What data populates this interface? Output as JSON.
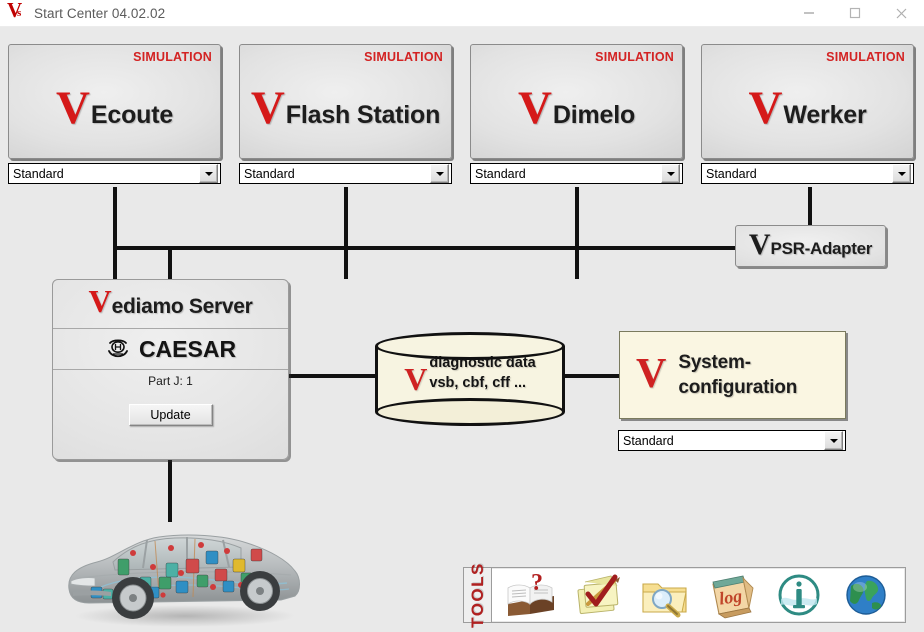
{
  "window": {
    "title": "Start Center 04.02.02",
    "logo_letter": "V",
    "logo_sub": "s",
    "controls": {
      "minimize": "minimize-button",
      "maximize": "maximize-button",
      "close": "close-button"
    }
  },
  "colors": {
    "brand_red": "#d51919",
    "simulation_red": "#d32323",
    "canvas_bg": "#e9e9e9",
    "tile_bg": "#e2e2e2",
    "db_fill": "#f7f4e1",
    "sysconf_fill": "#faf6e2",
    "tools_label_red": "#b02020",
    "line_color": "#111111"
  },
  "tiles": [
    {
      "badge": "SIMULATION",
      "mark": "V",
      "name": "Ecoute",
      "profile": "Standard"
    },
    {
      "badge": "SIMULATION",
      "mark": "V",
      "name": "Flash Station",
      "profile": "Standard"
    },
    {
      "badge": "SIMULATION",
      "mark": "V",
      "name": "Dimelo",
      "profile": "Standard"
    },
    {
      "badge": "SIMULATION",
      "mark": "V",
      "name": "Werker",
      "profile": "Standard"
    }
  ],
  "psr_adapter": {
    "mark": "V",
    "name": "PSR-Adapter"
  },
  "server": {
    "mark": "V",
    "title": "ediamo Server",
    "caesar_label": "CAESAR",
    "part_info": "Part J: 1",
    "update_button": "Update"
  },
  "database": {
    "mark": "V",
    "line1": "diagnostic data",
    "line2": "vsb, cbf, cff ..."
  },
  "system_configuration": {
    "mark": "V",
    "line1": "System-",
    "line2": "configuration",
    "profile": "Standard"
  },
  "tools": {
    "label": "TOOLS",
    "icons": [
      {
        "name": "help-book-icon",
        "title": "Help"
      },
      {
        "name": "notepad-check-icon",
        "title": "Notes"
      },
      {
        "name": "folder-search-icon",
        "title": "Search"
      },
      {
        "name": "log-book-icon",
        "title": "Log"
      },
      {
        "name": "info-circle-icon",
        "title": "Info"
      },
      {
        "name": "globe-icon",
        "title": "Web"
      }
    ]
  },
  "vehicle": {
    "name": "vehicle-diagram"
  }
}
